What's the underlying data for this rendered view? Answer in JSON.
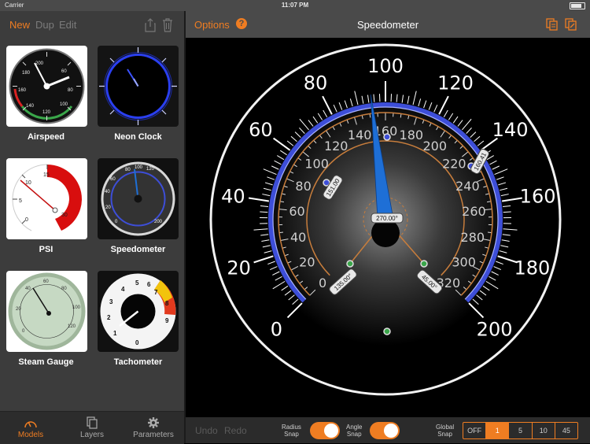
{
  "status_bar": {
    "carrier": "Carrier",
    "time": "11:07 PM"
  },
  "sidebar": {
    "new_label": "New",
    "dup_label": "Dup",
    "edit_label": "Edit",
    "models": [
      {
        "name": "Airspeed",
        "ticks": [
          "200",
          "180",
          "160",
          "140",
          "120",
          "100",
          "80",
          "60"
        ]
      },
      {
        "name": "Neon Clock"
      },
      {
        "name": "PSI",
        "ticks": [
          "15",
          "10",
          "5",
          "0",
          "30"
        ]
      },
      {
        "name": "Speedometer",
        "ticks": [
          "80",
          "100",
          "120",
          "60",
          "40",
          "20",
          "0",
          "200"
        ]
      },
      {
        "name": "Steam Gauge",
        "ticks": [
          "40",
          "60",
          "80",
          "100",
          "120",
          "20",
          "0"
        ]
      },
      {
        "name": "Tachometer",
        "ticks": [
          "5",
          "6",
          "7",
          "4",
          "3",
          "2",
          "1",
          "0",
          "8",
          "9"
        ]
      }
    ],
    "tabs": [
      {
        "label": "Models",
        "active": true
      },
      {
        "label": "Layers",
        "active": false
      },
      {
        "label": "Parameters",
        "active": false
      }
    ]
  },
  "toolbar": {
    "options_label": "Options",
    "help_symbol": "?",
    "title": "Speedometer"
  },
  "gauge": {
    "outer_labels": [
      "0",
      "20",
      "40",
      "60",
      "80",
      "100",
      "120",
      "140",
      "160",
      "180",
      "200"
    ],
    "inner_labels": [
      "0",
      "20",
      "40",
      "60",
      "80",
      "100",
      "120",
      "140",
      "160",
      "180",
      "200",
      "220",
      "240",
      "260",
      "280",
      "300",
      "320"
    ],
    "needle_value": 95,
    "handles": {
      "center_angle": "270.00°",
      "left_angle": "135.00°",
      "right_angle": "45.00°",
      "inner_left": "151.00",
      "inner_right": "160.41"
    }
  },
  "bottom_bar": {
    "undo_label": "Undo",
    "redo_label": "Redo",
    "radius_snap_line1": "Radius",
    "radius_snap_line2": "Snap",
    "angle_snap_line1": "Angle",
    "angle_snap_line2": "Snap",
    "global_snap_line1": "Global",
    "global_snap_line2": "Snap",
    "snap_options": [
      "OFF",
      "1",
      "5",
      "10",
      "45"
    ],
    "snap_selected": "1"
  },
  "colors": {
    "accent": "#ef7d22",
    "gauge_ring": "#3d4ed8",
    "needle": "#1e6fd6",
    "inner_scale": "#c77d3c"
  }
}
